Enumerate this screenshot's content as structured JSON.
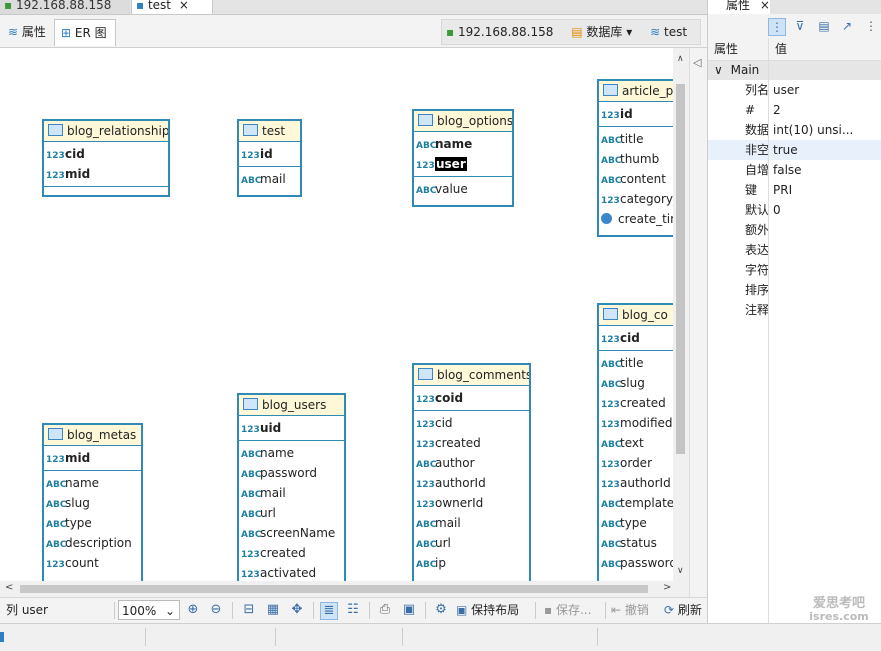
{
  "editor_tabs": [
    {
      "label": "192.168.88.158"
    },
    {
      "label": "test",
      "close": "×"
    }
  ],
  "sub_tabs": [
    {
      "label": "属性"
    },
    {
      "label": "ER 图"
    }
  ],
  "connection": {
    "host": "192.168.88.158",
    "database_label": "数据库",
    "schema": "test"
  },
  "er_tables": [
    {
      "id": "blog_relationships",
      "name": "blog_relationships",
      "pk": [
        {
          "icon": "123",
          "name": "cid"
        },
        {
          "icon": "123",
          "name": "mid"
        }
      ],
      "cols": []
    },
    {
      "id": "test",
      "name": "test",
      "pk": [
        {
          "icon": "123",
          "name": "id"
        }
      ],
      "cols": [
        {
          "icon": "ABC",
          "name": "mail"
        }
      ]
    },
    {
      "id": "blog_options",
      "name": "blog_options",
      "pk": [
        {
          "icon": "ABC",
          "name": "name"
        },
        {
          "icon": "123",
          "name": "user",
          "selected": true
        }
      ],
      "cols": [
        {
          "icon": "ABC",
          "name": "value"
        }
      ]
    },
    {
      "id": "article_p",
      "name": "article_p",
      "pk": [
        {
          "icon": "123",
          "name": "id"
        }
      ],
      "cols": [
        {
          "icon": "ABC",
          "name": "title"
        },
        {
          "icon": "ABC",
          "name": "thumb"
        },
        {
          "icon": "ABC",
          "name": "content"
        },
        {
          "icon": "123",
          "name": "category_"
        },
        {
          "icon": "clock",
          "name": "create_tim"
        }
      ]
    },
    {
      "id": "blog_co",
      "name": "blog_co",
      "pk": [
        {
          "icon": "123",
          "name": "cid"
        }
      ],
      "cols": [
        {
          "icon": "ABC",
          "name": "title"
        },
        {
          "icon": "ABC",
          "name": "slug"
        },
        {
          "icon": "123",
          "name": "created"
        },
        {
          "icon": "123",
          "name": "modified"
        },
        {
          "icon": "ABC",
          "name": "text"
        },
        {
          "icon": "123",
          "name": "order"
        },
        {
          "icon": "123",
          "name": "authorId"
        },
        {
          "icon": "ABC",
          "name": "template"
        },
        {
          "icon": "ABC",
          "name": "type"
        },
        {
          "icon": "ABC",
          "name": "status"
        },
        {
          "icon": "ABC",
          "name": "password"
        }
      ]
    },
    {
      "id": "blog_comments",
      "name": "blog_comments",
      "pk": [
        {
          "icon": "123",
          "name": "coid"
        }
      ],
      "cols": [
        {
          "icon": "123",
          "name": "cid"
        },
        {
          "icon": "123",
          "name": "created"
        },
        {
          "icon": "ABC",
          "name": "author"
        },
        {
          "icon": "123",
          "name": "authorId"
        },
        {
          "icon": "123",
          "name": "ownerId"
        },
        {
          "icon": "ABC",
          "name": "mail"
        },
        {
          "icon": "ABC",
          "name": "url"
        },
        {
          "icon": "ABC",
          "name": "ip"
        }
      ]
    },
    {
      "id": "blog_users",
      "name": "blog_users",
      "pk": [
        {
          "icon": "123",
          "name": "uid"
        }
      ],
      "cols": [
        {
          "icon": "ABC",
          "name": "name"
        },
        {
          "icon": "ABC",
          "name": "password"
        },
        {
          "icon": "ABC",
          "name": "mail"
        },
        {
          "icon": "ABC",
          "name": "url"
        },
        {
          "icon": "ABC",
          "name": "screenName"
        },
        {
          "icon": "123",
          "name": "created"
        },
        {
          "icon": "123",
          "name": "activated"
        }
      ]
    },
    {
      "id": "blog_metas",
      "name": "blog_metas",
      "pk": [
        {
          "icon": "123",
          "name": "mid"
        }
      ],
      "cols": [
        {
          "icon": "ABC",
          "name": "name"
        },
        {
          "icon": "ABC",
          "name": "slug"
        },
        {
          "icon": "ABC",
          "name": "type"
        },
        {
          "icon": "ABC",
          "name": "description"
        },
        {
          "icon": "123",
          "name": "count"
        }
      ]
    }
  ],
  "statusbar": {
    "selection": "列 user",
    "zoom": "100%",
    "save_layout": "保持布局",
    "save": "保存...",
    "undo": "撤销",
    "refresh": "刷新"
  },
  "watermark": "爱思考吧\nisres.com",
  "properties_panel": {
    "tab_label": "属性",
    "tab_close": "×",
    "col_name": "属性",
    "col_value": "值",
    "group": "Main",
    "rows": [
      {
        "key": "列名",
        "value": "user"
      },
      {
        "key": "#",
        "value": "2"
      },
      {
        "key": "数据",
        "value": "int(10) unsi..."
      },
      {
        "key": "非空",
        "value": "true",
        "selected": true
      },
      {
        "key": "自增",
        "value": "false"
      },
      {
        "key": "键",
        "value": "PRI"
      },
      {
        "key": "默认",
        "value": "0"
      },
      {
        "key": "额外",
        "value": ""
      },
      {
        "key": "表达",
        "value": ""
      },
      {
        "key": "字符",
        "value": ""
      },
      {
        "key": "排序",
        "value": ""
      },
      {
        "key": "注释",
        "value": ""
      }
    ]
  },
  "colors": {
    "table_border": "#2f8bb6",
    "table_header": "#fff8d8",
    "selection": "#e8f1fb"
  }
}
